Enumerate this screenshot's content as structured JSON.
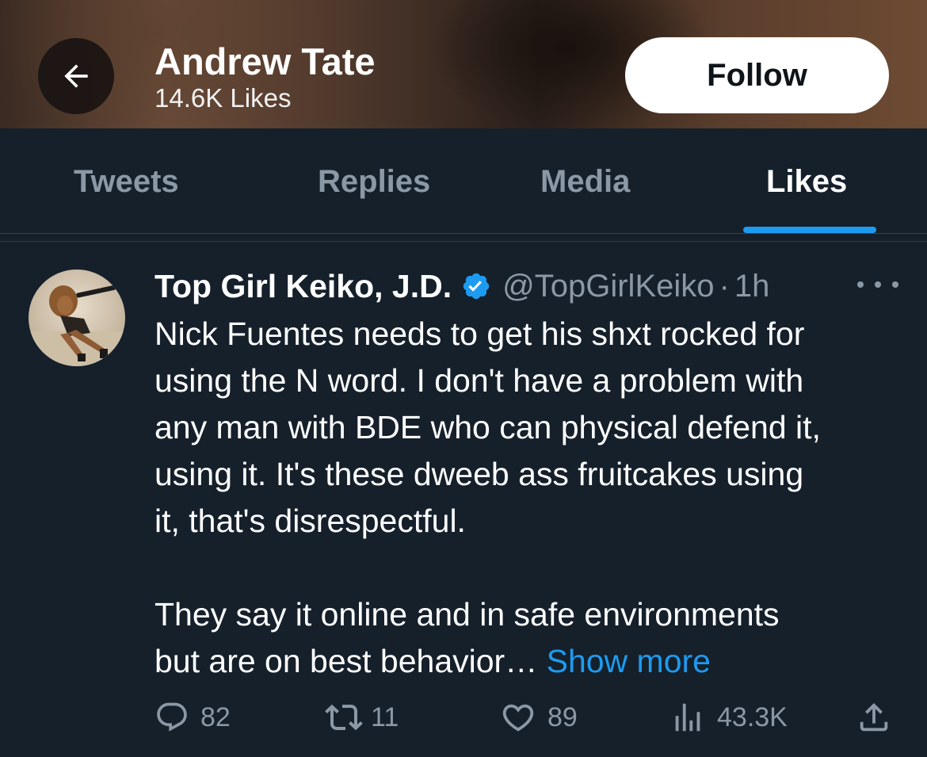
{
  "header": {
    "back_icon": "arrow-left-icon",
    "title": "Andrew Tate",
    "subtitle": "14.6K Likes",
    "follow_label": "Follow"
  },
  "tabs": [
    {
      "label": "Tweets",
      "active": false
    },
    {
      "label": "Replies",
      "active": false
    },
    {
      "label": "Media",
      "active": false
    },
    {
      "label": "Likes",
      "active": true
    }
  ],
  "tweet": {
    "author_name": "Top Girl Keiko, J.D.",
    "verified_icon": "verified-badge-icon",
    "handle": "@TopGirlKeiko",
    "separator": "·",
    "time": "1h",
    "more_icon": "more-horizontal-icon",
    "text_lines": [
      "Nick Fuentes needs to get his shxt rocked for",
      "using the N word. I don't have a problem with",
      "any man with BDE who can physical defend it,",
      "using it. It's these dweeb ass fruitcakes using",
      "it, that's disrespectful."
    ],
    "text_lines_2": [
      "They say it online and in safe environments",
      "but are on best behavior…"
    ],
    "show_more": "Show more",
    "actions": {
      "replies": "82",
      "retweets": "11",
      "likes": "89",
      "views": "43.3K"
    }
  },
  "colors": {
    "background": "#15202b",
    "accent": "#1d9bf0",
    "muted": "#8b98a5",
    "text": "#ffffff"
  }
}
